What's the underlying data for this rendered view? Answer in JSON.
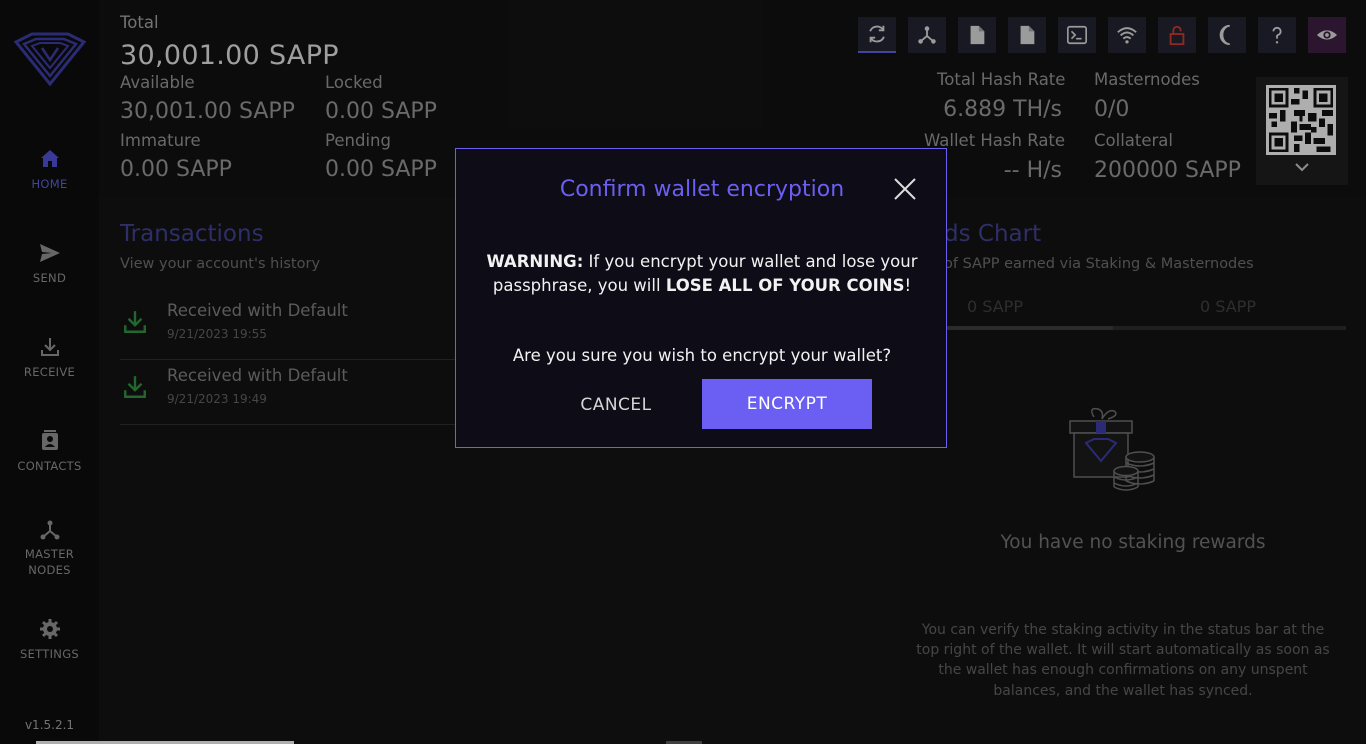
{
  "sidebar": {
    "items": [
      {
        "label": "HOME"
      },
      {
        "label": "SEND"
      },
      {
        "label": "RECEIVE"
      },
      {
        "label": "CONTACTS"
      },
      {
        "label": "MASTER"
      },
      {
        "label": "NODES"
      },
      {
        "label": "SETTINGS"
      }
    ],
    "version": "v1.5.2.1"
  },
  "header": {
    "total_label": "Total",
    "total_value": "30,001.00 SAPP",
    "available_label": "Available",
    "available_value": "30,001.00 SAPP",
    "locked_label": "Locked",
    "locked_value": "0.00 SAPP",
    "immature_label": "Immature",
    "immature_value": "0.00 SAPP",
    "pending_label": "Pending",
    "pending_value": "0.00 SAPP",
    "total_hash_label": "Total Hash Rate",
    "total_hash_value": "6.889 TH/s",
    "masternodes_label": "Masternodes",
    "masternodes_value": "0/0",
    "wallet_hash_label": "Wallet Hash Rate",
    "wallet_hash_value": "-- H/s",
    "collateral_label": "Collateral",
    "collateral_value": "200000 SAPP",
    "toolbar_icons": [
      "refresh-icon",
      "network-icon",
      "document-icon",
      "document-icon",
      "terminal-icon",
      "wifi-icon",
      "unlocked-icon",
      "moon-icon",
      "help-icon",
      "eye-icon"
    ]
  },
  "transactions": {
    "title": "Transactions",
    "subtitle": "View your account's history",
    "rows": [
      {
        "title": "Received with Default",
        "date": "9/21/2023 19:55"
      },
      {
        "title": "Received with Default",
        "date": "9/21/2023 19:49"
      }
    ]
  },
  "rewards": {
    "title": "ds Chart",
    "subtitle": "of SAPP earned via Staking & Masternodes",
    "tab1": "0 SAPP",
    "tab2": "0 SAPP",
    "empty_title": "You have no staking rewards",
    "empty_desc": "You can verify the staking activity in the status bar at the top right of the wallet. It will start automatically as soon as the wallet has enough confirmations on any unspent balances, and the wallet has synced."
  },
  "modal": {
    "title": "Confirm wallet encryption",
    "warning_label": "WARNING:",
    "warning_text_1": " If you encrypt your wallet and lose your passphrase, you will ",
    "warning_bold": "LOSE ALL OF YOUR COINS",
    "warning_end": "!",
    "question": "Are you sure you wish to encrypt your wallet?",
    "cancel_label": "CANCEL",
    "encrypt_label": "ENCRYPT"
  },
  "colors": {
    "accent": "#6a5ff2",
    "background": "#131313",
    "received_icon": "#2e8b3e"
  }
}
